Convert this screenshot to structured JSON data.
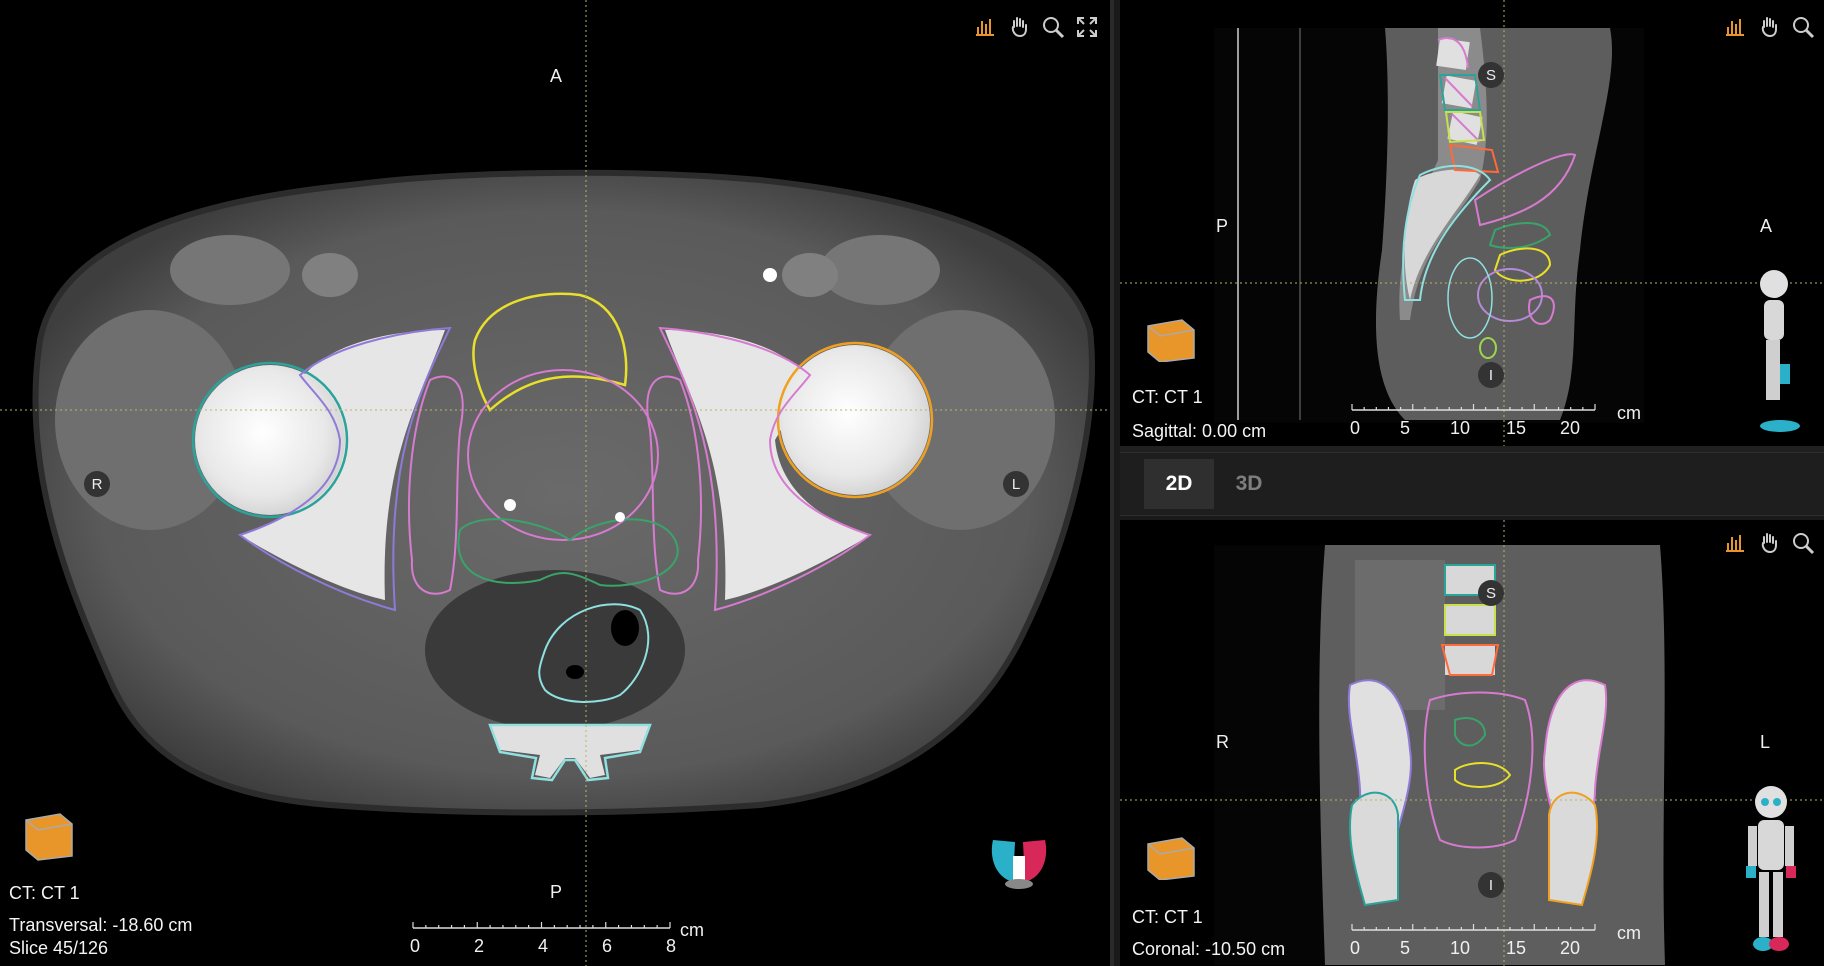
{
  "transversal": {
    "orientation": {
      "top": "A",
      "bottom": "P",
      "left": "R",
      "right": "L"
    },
    "info_ct": "CT: CT 1",
    "info_position": "Transversal: -18.60 cm",
    "info_slice": "Slice 45/126",
    "scale": {
      "unit": "cm",
      "ticks": [
        "0",
        "2",
        "4",
        "6",
        "8"
      ]
    },
    "toolbar": [
      "window-level-icon",
      "pan-hand-icon",
      "zoom-icon",
      "fullscreen-icon"
    ]
  },
  "sagittal": {
    "orientation": {
      "top": "S",
      "bottom": "I",
      "left": "P",
      "right": "A"
    },
    "info_ct": "CT: CT 1",
    "info_position": "Sagittal: 0.00 cm",
    "scale": {
      "unit": "cm",
      "ticks": [
        "0",
        "5",
        "10",
        "15",
        "20"
      ]
    },
    "toolbar": [
      "window-level-icon",
      "pan-hand-icon",
      "zoom-icon"
    ]
  },
  "coronal": {
    "orientation": {
      "top": "S",
      "bottom": "I",
      "left": "R",
      "right": "L"
    },
    "info_ct": "CT: CT 1",
    "info_position": "Coronal: -10.50 cm",
    "scale": {
      "unit": "cm",
      "ticks": [
        "0",
        "5",
        "10",
        "15",
        "20"
      ]
    },
    "toolbar": [
      "window-level-icon",
      "pan-hand-icon",
      "zoom-icon"
    ]
  },
  "tabs": [
    {
      "label": "2D",
      "active": true
    },
    {
      "label": "3D",
      "active": false
    }
  ],
  "colors": {
    "accent_orange": "#e8952a",
    "contour_teal": "#2aa39a",
    "contour_violet": "#8f7ad8",
    "contour_pink": "#d77bd0",
    "contour_yellow": "#e8e02a",
    "contour_green": "#3aa36a",
    "contour_cyan": "#8fe0e0",
    "contour_orange": "#f0a020",
    "crosshair": "#b8b070"
  }
}
